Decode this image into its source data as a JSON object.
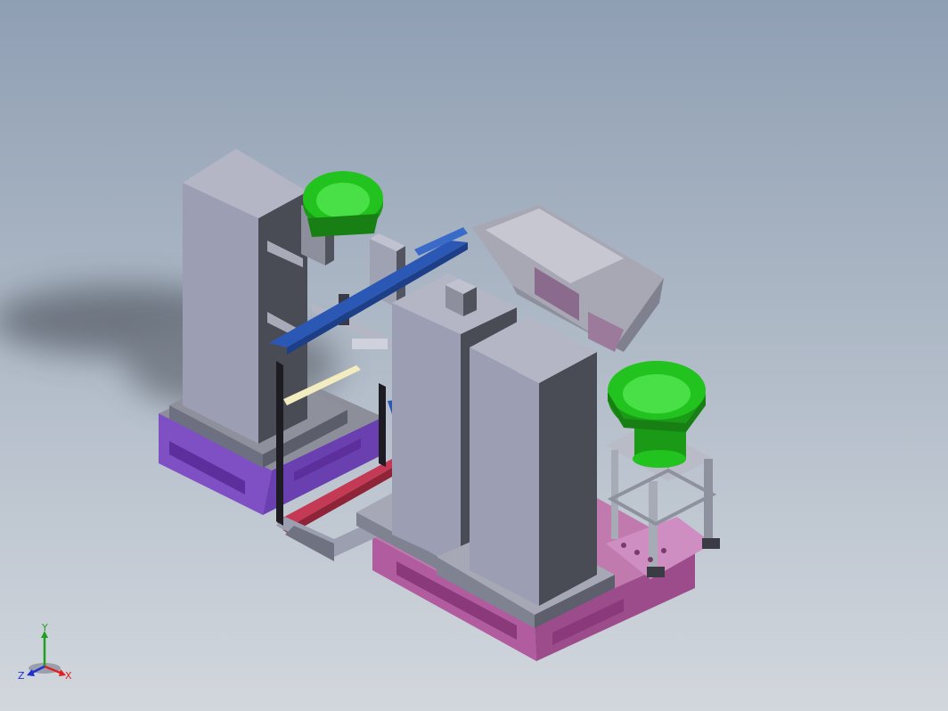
{
  "viewport": {
    "background_top": "#8f9fb3",
    "background_bottom": "#d2d7dd"
  },
  "model": {
    "parts": [
      "left-tower",
      "right-tower-front",
      "right-tower-back",
      "left-vibratory-bowl",
      "right-vibratory-bowl",
      "hopper",
      "blue-conveyor-rail",
      "purple-base-left",
      "magenta-base-right",
      "stand-frame",
      "red-rail"
    ],
    "colors": {
      "tower": "#9c9fb3",
      "tower_shadow": "#494c54",
      "bowl": "#23c31f",
      "rail": "#2b58b5",
      "base_left": "#7f4fc4",
      "base_right": "#b05c9e",
      "hopper": "#a7a8b4",
      "frame": "#a7abb6",
      "red_rail": "#c43a55"
    }
  },
  "triad": {
    "x_label": "X",
    "y_label": "Y",
    "z_label": "Z",
    "x_color": "#e02020",
    "y_color": "#20a020",
    "z_color": "#2030d0"
  }
}
